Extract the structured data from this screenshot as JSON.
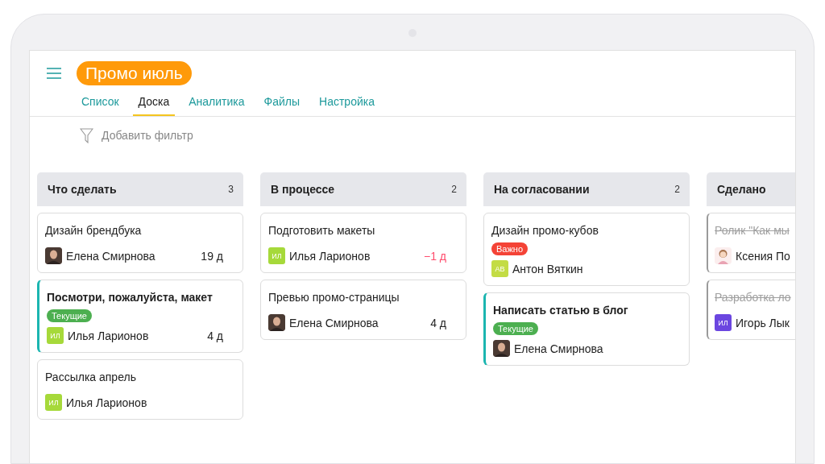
{
  "project": {
    "title": "Промо июль"
  },
  "tabs": [
    {
      "label": "Список",
      "selected": false
    },
    {
      "label": "Доска",
      "selected": true
    },
    {
      "label": "Аналитика",
      "selected": false
    },
    {
      "label": "Файлы",
      "selected": false
    },
    {
      "label": "Настройка",
      "selected": false
    }
  ],
  "filter": {
    "label": "Добавить фильтр"
  },
  "columns": [
    {
      "title": "Что сделать",
      "count": "3",
      "cards": [
        {
          "title": "Дизайн брендбука",
          "highlighted": false,
          "done": false,
          "assignee": {
            "name": "Елена Смирнова",
            "avatar": {
              "kind": "photo"
            }
          },
          "due": {
            "text": "19 д",
            "overdue": false
          }
        },
        {
          "title": "Посмотри, пожалуйста, макет",
          "highlighted": true,
          "done": false,
          "tag": {
            "label": "Текущие",
            "color": "#4caf50"
          },
          "assignee": {
            "name": "Илья Ларионов",
            "avatar": {
              "kind": "initials",
              "initials": "ИЛ",
              "color": "#a6d93a"
            }
          },
          "due": {
            "text": "4 д",
            "overdue": false
          }
        },
        {
          "title": "Рассылка апрель",
          "highlighted": false,
          "done": false,
          "assignee": {
            "name": "Илья Ларионов",
            "avatar": {
              "kind": "initials",
              "initials": "ИЛ",
              "color": "#a6d93a"
            }
          }
        }
      ]
    },
    {
      "title": "В процессе",
      "count": "2",
      "cards": [
        {
          "title": "Подготовить макеты",
          "highlighted": false,
          "done": false,
          "assignee": {
            "name": "Илья Ларионов",
            "avatar": {
              "kind": "initials",
              "initials": "ИЛ",
              "color": "#a6d93a"
            }
          },
          "due": {
            "text": "−1 д",
            "overdue": true
          }
        },
        {
          "title": "Превью промо-страницы",
          "highlighted": false,
          "done": false,
          "assignee": {
            "name": "Елена Смирнова",
            "avatar": {
              "kind": "photo"
            }
          },
          "due": {
            "text": "4 д",
            "overdue": false
          }
        }
      ]
    },
    {
      "title": "На согласовании",
      "count": "2",
      "cards": [
        {
          "title": "Дизайн промо-кубов",
          "highlighted": false,
          "done": false,
          "tag": {
            "label": "Важно",
            "color": "#f44336"
          },
          "assignee": {
            "name": "Антон Вяткин",
            "avatar": {
              "kind": "initials",
              "initials": "АВ",
              "color": "#c3dc45"
            }
          }
        },
        {
          "title": "Написать статью в блог",
          "highlighted": true,
          "done": false,
          "tag": {
            "label": "Текущие",
            "color": "#4caf50"
          },
          "assignee": {
            "name": "Елена Смирнова",
            "avatar": {
              "kind": "photo"
            }
          }
        }
      ]
    },
    {
      "title": "Сделано",
      "cards": [
        {
          "title": "Ролик \"Как мы",
          "highlighted": false,
          "done": true,
          "assignee": {
            "name": "Ксения По",
            "avatar": {
              "kind": "cartoon"
            }
          }
        },
        {
          "title": "Разработка ло",
          "highlighted": false,
          "done": true,
          "assignee": {
            "name": "Игорь Лык",
            "avatar": {
              "kind": "initials",
              "initials": "ИЛ",
              "color": "#6b46e0"
            }
          }
        }
      ]
    }
  ]
}
